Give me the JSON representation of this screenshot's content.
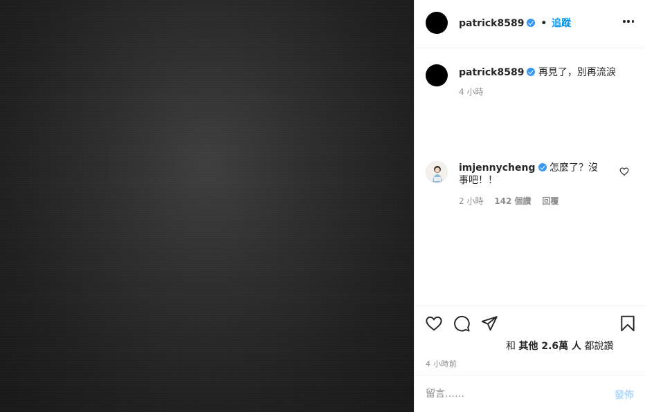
{
  "post": {
    "image_description": "",
    "author": {
      "username": "patrick8589",
      "verified": true,
      "follow_label": "追蹤",
      "separator": "•"
    },
    "caption": {
      "username": "patrick8589",
      "text": "再見了，別再流淚",
      "time": "4 小時"
    },
    "comments": [
      {
        "username": "imjennycheng",
        "verified": true,
        "text": "怎麼了？沒事吧！！",
        "time": "2 小時",
        "likes": "142 個讚",
        "reply_label": "回覆"
      }
    ],
    "likes_summary": {
      "prefix": "和",
      "others": "其他 2.6萬 人",
      "suffix": "都說讚"
    },
    "posted_time": "4 小時前",
    "comment_box": {
      "placeholder": "留言……",
      "post_label": "發佈"
    }
  },
  "icons": {
    "more": "more-horizontal-icon",
    "like": "heart-icon",
    "comment": "comment-bubble-icon",
    "share": "paper-plane-icon",
    "save": "bookmark-icon"
  },
  "colors": {
    "accent": "#0095f6",
    "verified": "#3897f0",
    "secondary_text": "#8e8e8e",
    "post_button_disabled": "#b3dbff"
  }
}
